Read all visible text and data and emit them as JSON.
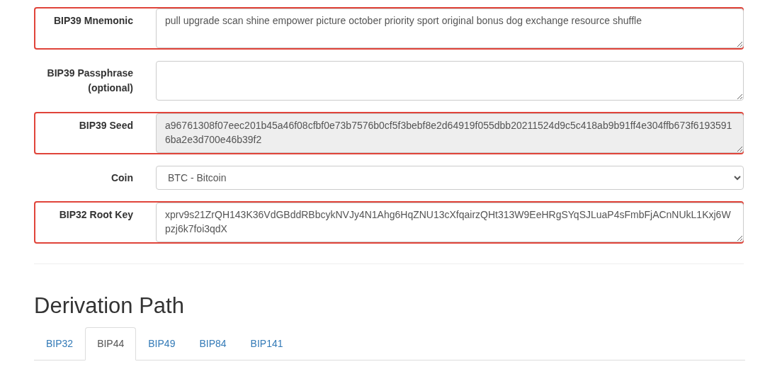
{
  "fields": [
    {
      "label": "BIP39 Mnemonic",
      "kind": "textarea",
      "value": "pull upgrade scan shine empower picture october priority sport original bonus dog exchange resource shuffle",
      "readonly": false,
      "highlighted": true
    },
    {
      "label": "BIP39 Passphrase (optional)",
      "kind": "textarea",
      "readonly": false,
      "highlighted": false
    },
    {
      "label": "BIP39 Seed",
      "kind": "textarea",
      "value": "a96761308f07eec201b45a46f08cfbf0e73b7576b0cf5f3bebf8e2d64919f055dbb20211524d9c5c418ab9b91ff4e304ffb673f61935916ba2e3d700e46b39f2",
      "readonly": true,
      "highlighted": true
    },
    {
      "label": "Coin",
      "kind": "select",
      "value": "BTC - Bitcoin",
      "readonly": false,
      "highlighted": false
    },
    {
      "label": "BIP32 Root Key",
      "kind": "textarea",
      "value": "xprv9s21ZrQH143K36VdGBddRBbcykNVJy4N1Ahg6HqZNU13cXfqairzQHt313W9EeHRgSYqSJLuaP4sFmbFjACnNUkL1Kxj6Wpzj6k7foi3qdX",
      "readonly": false,
      "highlighted": true
    }
  ],
  "heading": "Derivation Path",
  "tabs": [
    {
      "label": "BIP32",
      "selected": false
    },
    {
      "label": "BIP44",
      "selected": true
    },
    {
      "label": "BIP49",
      "selected": false
    },
    {
      "label": "BIP84",
      "selected": false
    },
    {
      "label": "BIP141",
      "selected": false
    }
  ]
}
